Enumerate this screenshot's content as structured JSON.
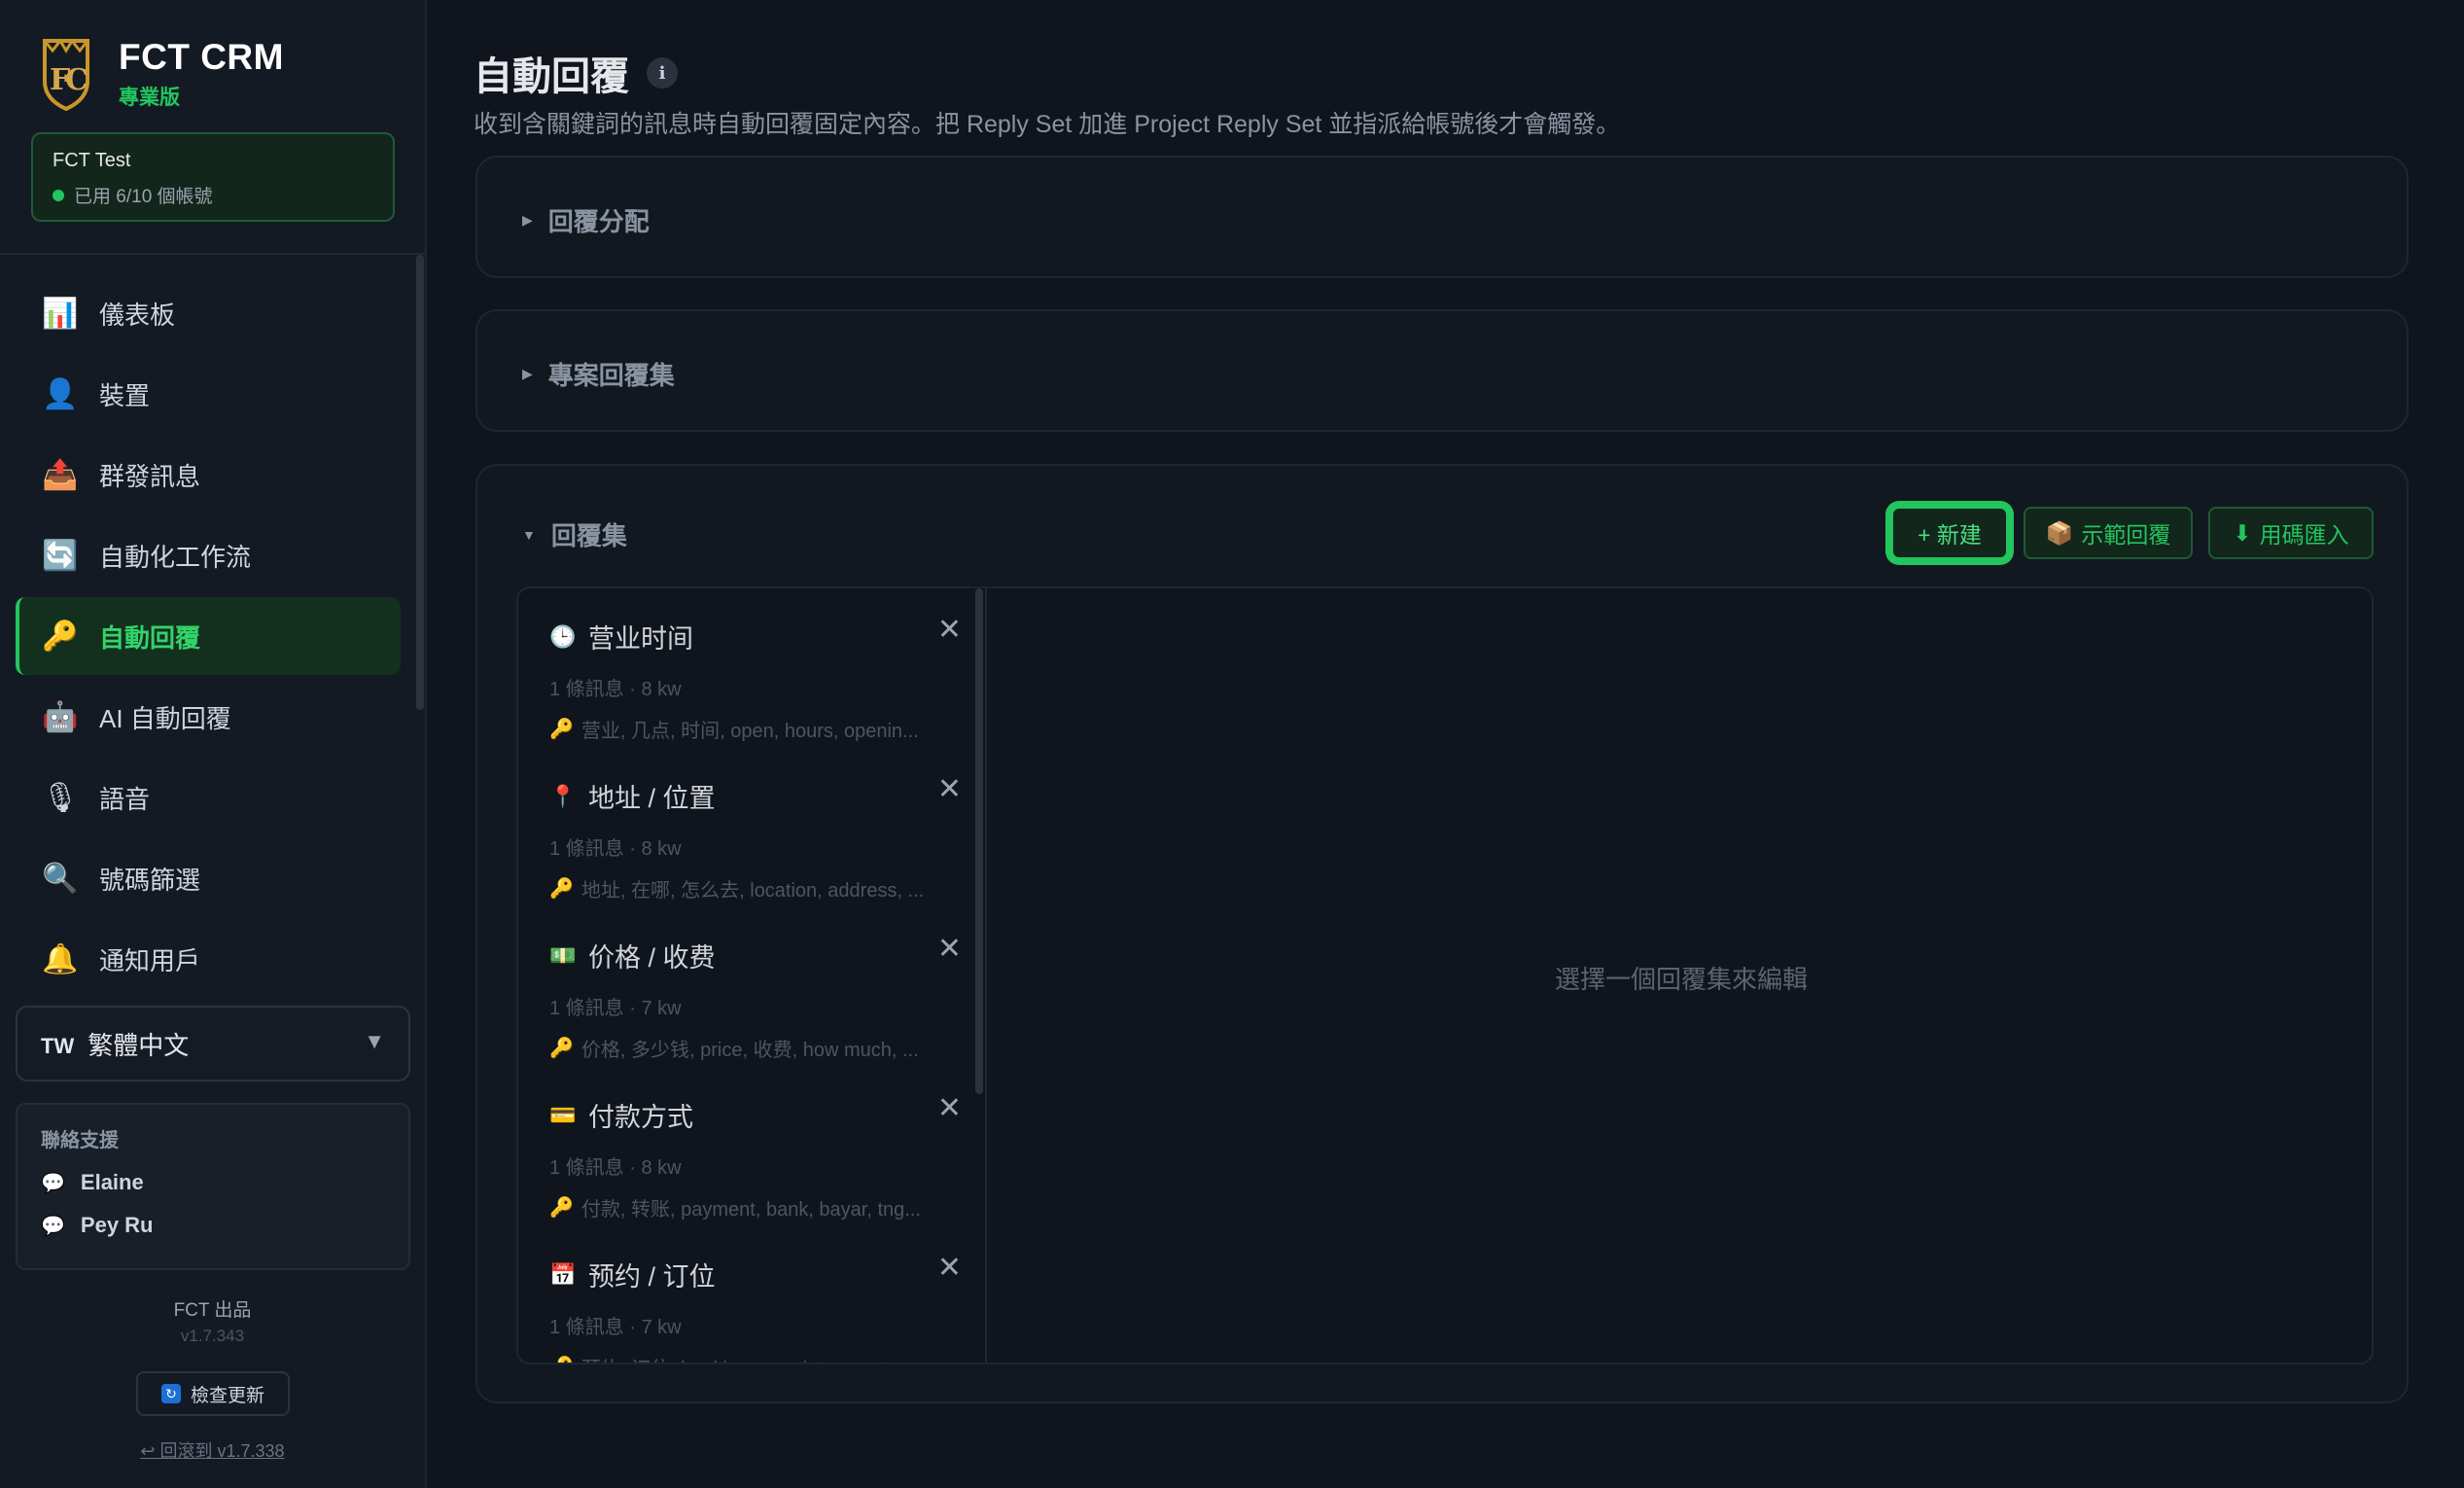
{
  "brand": {
    "title": "FCT CRM",
    "subtitle": "專業版"
  },
  "account": {
    "name": "FCT Test",
    "usage": "已用 6/10 個帳號"
  },
  "nav": [
    {
      "label": "儀表板",
      "icon": "chart-icon",
      "glyph": "📊"
    },
    {
      "label": "裝置",
      "icon": "user-icon",
      "glyph": "👤"
    },
    {
      "label": "群發訊息",
      "icon": "outbox-icon",
      "glyph": "📤"
    },
    {
      "label": "自動化工作流",
      "icon": "refresh-icon",
      "glyph": "🔄"
    },
    {
      "label": "自動回覆",
      "icon": "key-icon",
      "glyph": "🔑",
      "active": true
    },
    {
      "label": "AI 自動回覆",
      "icon": "robot-icon",
      "glyph": "🤖"
    },
    {
      "label": "語音",
      "icon": "microphone-icon",
      "glyph": "🎙"
    },
    {
      "label": "號碼篩選",
      "icon": "magnifier-icon",
      "glyph": "🔍"
    },
    {
      "label": "通知用戶",
      "icon": "bell-icon",
      "glyph": "🔔"
    }
  ],
  "language": {
    "flag": "TW",
    "label": "繁體中文"
  },
  "support": {
    "title": "聯絡支援",
    "contacts": [
      "Elaine",
      "Pey Ru"
    ]
  },
  "footer": {
    "brand": "FCT 出品",
    "version": "v1.7.343",
    "update_label": "檢查更新",
    "rollback_label": "↩ 回滾到 v1.7.338"
  },
  "page": {
    "title": "自動回覆",
    "description": "收到含關鍵詞的訊息時自動回覆固定內容。把 Reply Set 加進 Project Reply Set 並指派給帳號後才會觸發。"
  },
  "sections": {
    "assignment": "回覆分配",
    "project_sets": "專案回覆集",
    "reply_sets": "回覆集"
  },
  "buttons": {
    "new": "+ 新建",
    "demo": "示範回覆",
    "import": "用碼匯入"
  },
  "reply_sets": [
    {
      "title": "营业时间",
      "glyph": "🕒",
      "icon": "clock-icon",
      "meta": "1 條訊息 · 8 kw",
      "keywords": "营业, 几点, 时间, open, hours, openin..."
    },
    {
      "title": "地址 / 位置",
      "glyph": "📍",
      "icon": "pin-icon",
      "meta": "1 條訊息 · 8 kw",
      "keywords": "地址, 在哪, 怎么去, location, address, ..."
    },
    {
      "title": "价格 / 收费",
      "glyph": "💵",
      "icon": "money-icon",
      "meta": "1 條訊息 · 7 kw",
      "keywords": "价格, 多少钱, price, 收费, how much, ..."
    },
    {
      "title": "付款方式",
      "glyph": "💳",
      "icon": "card-icon",
      "meta": "1 條訊息 · 8 kw",
      "keywords": "付款, 转账, payment, bank, bayar, tng..."
    },
    {
      "title": "预约 / 订位",
      "glyph": "📅",
      "icon": "calendar-icon",
      "meta": "1 條訊息 · 7 kw",
      "keywords": "预约, 订位, booking, appointment, te..."
    }
  ],
  "empty_state": "選擇一個回覆集來編輯",
  "colors": {
    "accent": "#22c55e",
    "background": "#10151d",
    "sidebar": "#141a23"
  }
}
